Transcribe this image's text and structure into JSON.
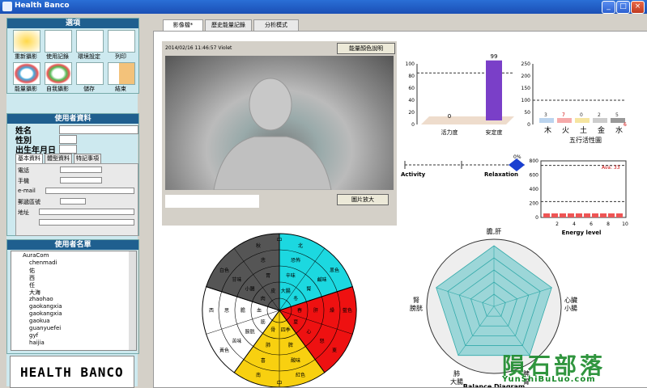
{
  "window": {
    "title": "Health Banco"
  },
  "options": {
    "title": "選項",
    "buttons": [
      "重新攝影",
      "使用記錄",
      "環境設定",
      "列印",
      "能量攝影",
      "自我攝影",
      "儲存",
      "結束"
    ]
  },
  "user_info": {
    "title": "使用者資料",
    "name_label": "姓名",
    "gender_label": "性別",
    "birth_label": "出生年月日",
    "tabs": [
      "基本資料",
      "體型資料",
      "特記事項"
    ],
    "phone_label": "電話",
    "mobile_label": "手機",
    "email_label": "e-mail",
    "zip_label": "郵遞區號",
    "address_label": "地址"
  },
  "user_list": {
    "title": "使用者名單",
    "root": "AuraCom",
    "items": [
      "chenmadi",
      "佑",
      "西",
      "任",
      "大海",
      "zhaohao",
      "gaokangxia",
      "gaokangxia",
      "gaokua",
      "guanyuefei",
      "gyf",
      "haijia"
    ]
  },
  "logo": "HEALTH BANCO",
  "main_tabs": [
    "影像檔*",
    "歷史能量記錄",
    "分析模式"
  ],
  "photo": {
    "caption": "2014/02/16  11:46:57  Violet",
    "legend_button": "能量顏色說明",
    "enlarge_button": "圖片放大"
  },
  "charts": {
    "bar1": {
      "ticks": [
        "0",
        "20",
        "40",
        "60",
        "80",
        "100"
      ],
      "labels": [
        "活力度",
        "安定度"
      ],
      "values": [
        0,
        99
      ],
      "value_labels": [
        "0",
        "99"
      ]
    },
    "five": {
      "ticks": [
        "0",
        "50",
        "100",
        "150",
        "200",
        "250"
      ],
      "labels": [
        "木",
        "火",
        "土",
        "金",
        "水"
      ],
      "values": [
        3,
        7,
        0,
        2,
        5
      ],
      "value_labels": [
        "3",
        "7",
        "0",
        "2",
        "5"
      ],
      "extra": "6",
      "title": "五行活性圖"
    },
    "slider": {
      "left": "Activity",
      "right": "Relaxation",
      "percent": "0%"
    },
    "energy": {
      "ticks": [
        "0",
        "200",
        "400",
        "600",
        "800"
      ],
      "xticks": [
        "2",
        "4",
        "6",
        "8",
        "10"
      ],
      "avg": "Ava: 33",
      "xlabel": "Energy level"
    }
  },
  "wheel": {
    "top": "中",
    "bottom": "中",
    "outer": [
      "北",
      "黑色",
      "藍色",
      "東",
      "紅色",
      "南",
      "黃色",
      "西",
      "白色",
      "秋"
    ],
    "inner": [
      "恐怖",
      "鹹味",
      "燥",
      "怒",
      "酸味",
      "喜",
      "苦味",
      "思",
      "甘味",
      "悲",
      "辛味",
      "腎",
      "肝",
      "心",
      "脾",
      "肺",
      "膀胱",
      "膽",
      "小腸",
      "胃",
      "大腸",
      "冬",
      "春",
      "夏",
      "四季",
      "骨",
      "筋",
      "血",
      "肉",
      "皮"
    ]
  },
  "radar": {
    "labels": [
      "膽,肝",
      "心臟\n小腸",
      "脾\n胃",
      "肺\n大腸",
      "腎\n膀胱"
    ],
    "title": "Balance Diagram"
  },
  "watermark": {
    "big": "隕石部落",
    "small": "YunShiBuLuo.com"
  }
}
